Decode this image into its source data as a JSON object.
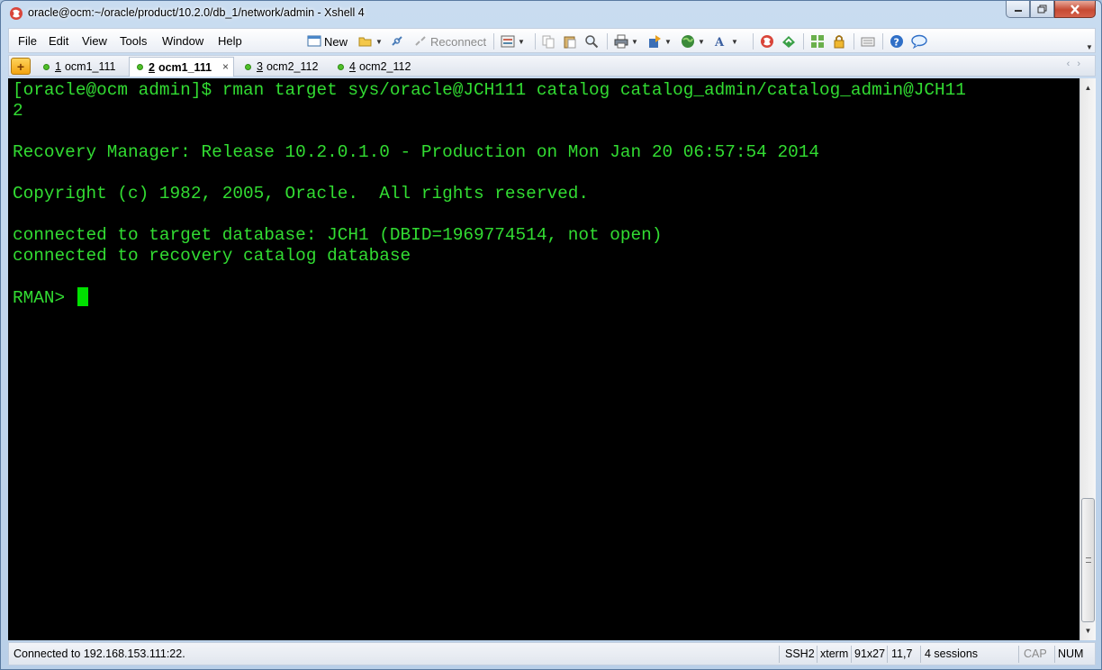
{
  "window": {
    "title": "oracle@ocm:~/oracle/product/10.2.0/db_1/network/admin - Xshell 4"
  },
  "menu": [
    "File",
    "Edit",
    "View",
    "Tools",
    "Window",
    "Help"
  ],
  "toolbar": {
    "new_label": "New",
    "reconnect_label": "Reconnect"
  },
  "tabs": [
    {
      "num": "1",
      "label": "ocm1_111",
      "active": false
    },
    {
      "num": "2",
      "label": "ocm1_111",
      "active": true
    },
    {
      "num": "3",
      "label": "ocm2_112",
      "active": false
    },
    {
      "num": "4",
      "label": "ocm2_112",
      "active": false
    }
  ],
  "terminal": {
    "lines": [
      "[oracle@ocm admin]$ rman target sys/oracle@JCH111 catalog catalog_admin/catalog_admin@JCH11",
      "2",
      "",
      "Recovery Manager: Release 10.2.0.1.0 - Production on Mon Jan 20 06:57:54 2014",
      "",
      "Copyright (c) 1982, 2005, Oracle.  All rights reserved.",
      "",
      "connected to target database: JCH1 (DBID=1969774514, not open)",
      "connected to recovery catalog database",
      ""
    ],
    "prompt": "RMAN> "
  },
  "status": {
    "connection": "Connected to 192.168.153.111:22.",
    "protocol": "SSH2",
    "term_type": "xterm",
    "size": "91x27",
    "cursor_pos": "11,7",
    "sessions": "4 sessions",
    "caps": "CAP",
    "num": "NUM"
  },
  "colors": {
    "terminal_bg": "#000000",
    "terminal_fg": "#32dc32",
    "cursor": "#00e000"
  }
}
